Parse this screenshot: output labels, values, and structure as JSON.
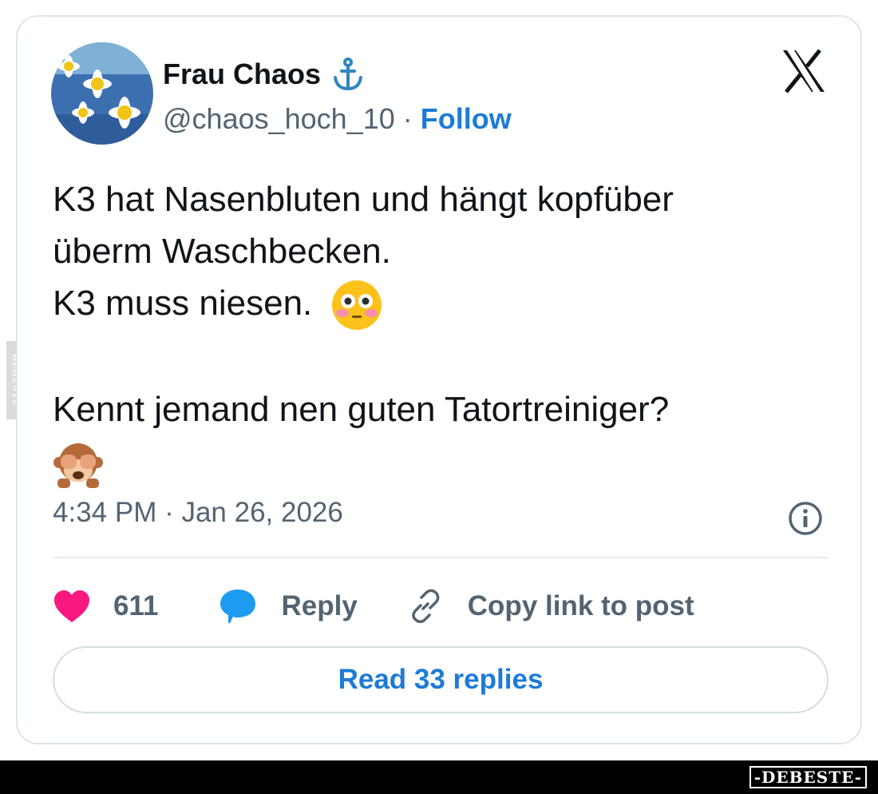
{
  "tweet": {
    "author_name": "Frau Chaos",
    "handle": "@chaos_hoch_10",
    "separator": "·",
    "follow_label": "Follow",
    "lines": [
      "K3 hat Nasenbluten und hängt kopfüber",
      "überm Waschbecken.",
      "K3 muss niesen."
    ],
    "question": "Kennt jemand nen guten Tatortreiniger?",
    "timestamp": "4:34 PM · Jan 26, 2026"
  },
  "actions": {
    "like_count": "611",
    "reply_label": "Reply",
    "copy_label": "Copy link to post"
  },
  "read_replies_label": "Read 33 replies",
  "watermark": {
    "side": "DEBESTE",
    "footer": "-DEBESTE-"
  },
  "colors": {
    "accent": "#1d7bd8",
    "like": "#f91880",
    "text": "#0f1419",
    "muted": "#536471"
  },
  "icons": [
    "anchor-icon",
    "x-logo-icon",
    "flushed-face-emoji",
    "see-no-evil-monkey-emoji",
    "info-icon",
    "heart-icon",
    "speech-bubble-icon",
    "link-icon"
  ]
}
